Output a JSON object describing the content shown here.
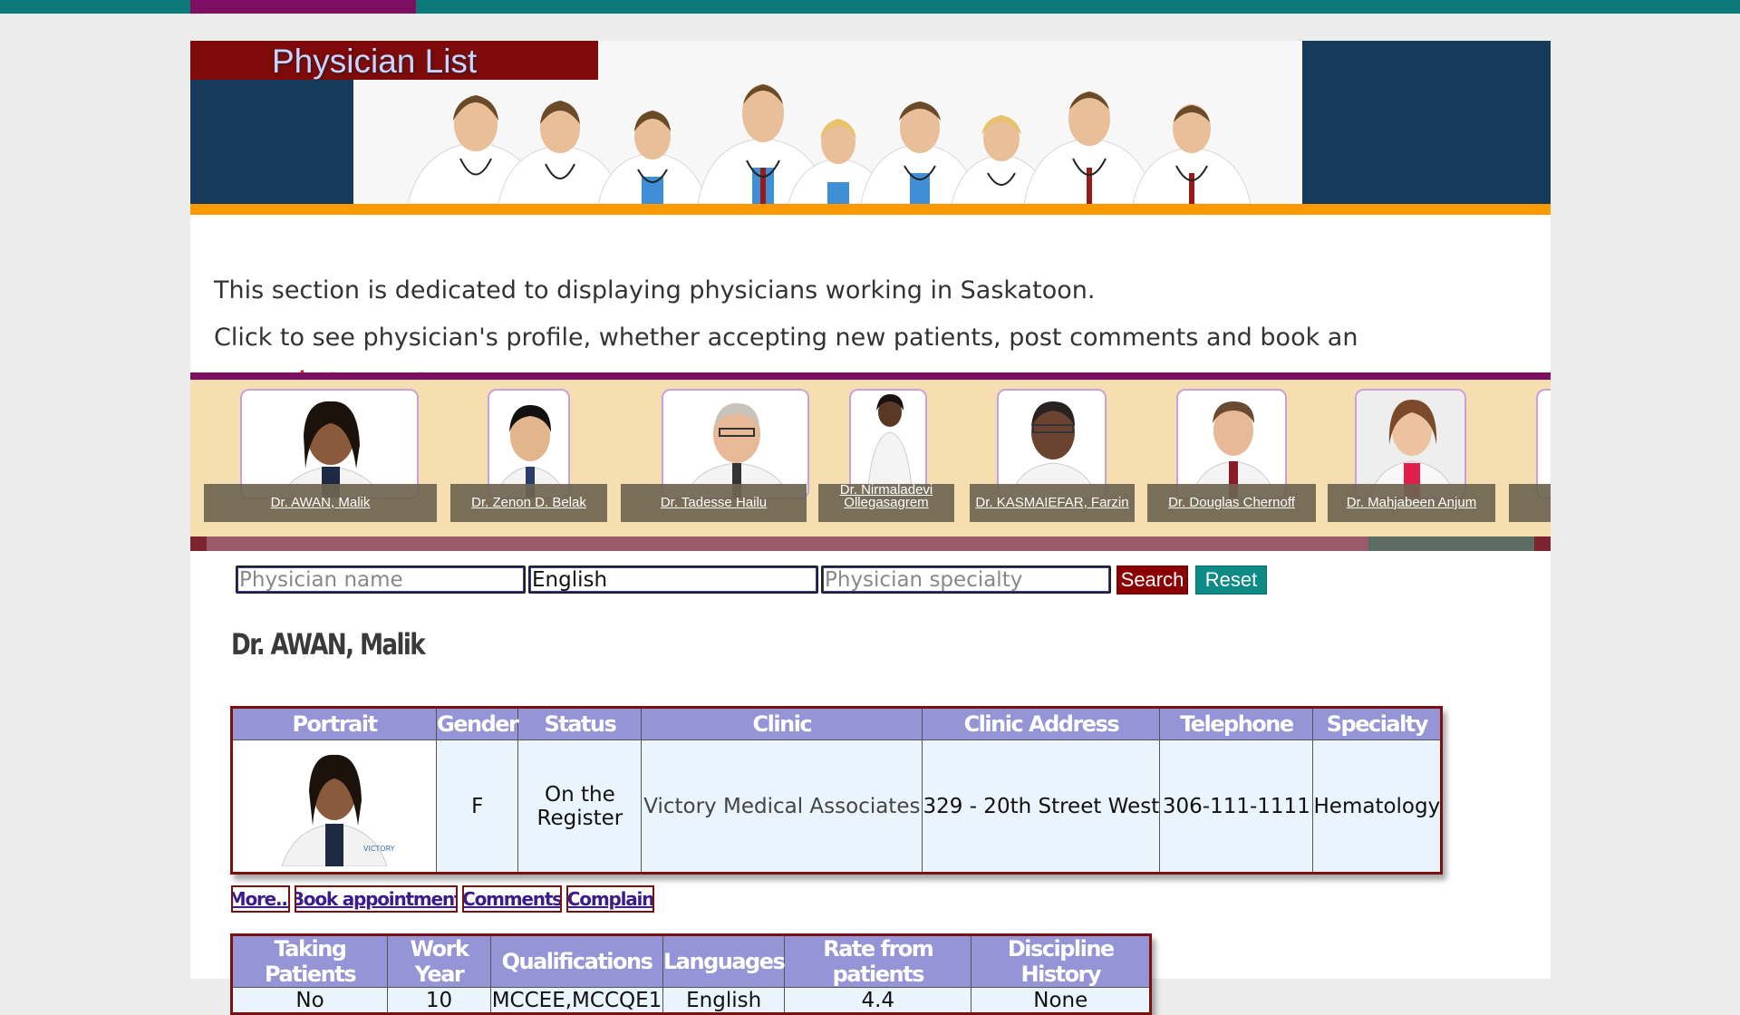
{
  "banner": {
    "title": "Physician List"
  },
  "intro": {
    "line1": "This section is dedicated to displaying physicians working in Saskatoon.",
    "line2": "Click to see physician's profile, whether accepting new patients, post comments and book an ",
    "link": "appointment",
    "tail": "!"
  },
  "carousel": {
    "items": [
      {
        "label": "Dr. AWAN, Malik"
      },
      {
        "label": "Dr. Zenon D. Belak"
      },
      {
        "label": "Dr. Tadesse Hailu"
      },
      {
        "label": "Dr. Nirmaladevi Ollegasagrem"
      },
      {
        "label": "Dr. KASMAIEFAR, Farzin"
      },
      {
        "label": "Dr. Douglas Chernoff"
      },
      {
        "label": "Dr. Mahjabeen Anjum"
      }
    ]
  },
  "search": {
    "name_placeholder": "Physician name",
    "language_value": "English",
    "specialty_placeholder": "Physician specialty",
    "search_label": "Search",
    "reset_label": "Reset"
  },
  "physician": {
    "name": "Dr. AWAN, Malik",
    "headers": [
      "Portrait",
      "Gender",
      "Status",
      "Clinic",
      "Clinic Address",
      "Telephone",
      "Specialty"
    ],
    "gender": "F",
    "status": "On the Register",
    "clinic": "Victory Medical Associates",
    "address": "329 - 20th Street West",
    "telephone": "306-111-1111",
    "specialty": "Hematology"
  },
  "actions": {
    "more": "More...",
    "book": "Book appointment",
    "comments": "Comments",
    "complain": "Complain"
  },
  "details": {
    "headers": [
      "Taking Patients",
      "Work Year",
      "Qualifications",
      "Languages",
      "Rate from patients",
      "Discipline History"
    ],
    "taking_patients": "No",
    "work_year": "10",
    "qualifications": "MCCEE,MCCQE1",
    "languages": "English",
    "rate": "4.4",
    "discipline": "None"
  },
  "colors": {
    "banner_navy": "#163a59",
    "accent_orange": "#ff9900",
    "accent_purple": "#7c0f62",
    "search_button": "#8b0000",
    "reset_button": "#0e8b86",
    "table_header": "#9494d6"
  }
}
